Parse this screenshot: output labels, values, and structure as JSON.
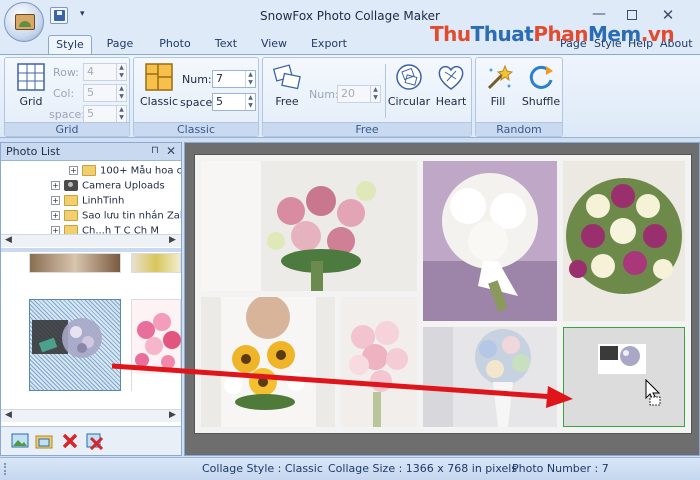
{
  "window": {
    "title": "SnowFox Photo Collage Maker",
    "qa_menu": "▾",
    "min": "—",
    "close": "✕"
  },
  "watermark": {
    "a": "Thu",
    "b": "Thuat",
    "c": "Phan",
    "d": "Mem",
    "e": ".vn"
  },
  "tabs": [
    "Style",
    "Page",
    "Photo",
    "Text",
    "View",
    "Export"
  ],
  "tabs_right": [
    "Page",
    "Style",
    "Help",
    "About"
  ],
  "ribbon": {
    "grid_group": {
      "label": "Grid",
      "button": "Grid",
      "row_label": "Row:",
      "row_value": "4",
      "col_label": "Col:",
      "col_value": "5",
      "space_label": "space:",
      "space_value": "5"
    },
    "classic_group": {
      "label": "Classic",
      "button": "Classic",
      "num_label": "Num:",
      "num_value": "7",
      "space_label": "space:",
      "space_value": "5"
    },
    "free_group": {
      "label": "Free",
      "free_button": "Free",
      "num_label": "Num:",
      "num_value": "20",
      "circular_button": "Circular",
      "heart_button": "Heart"
    },
    "random_group": {
      "label": "Random",
      "fill_button": "Fill",
      "shuffle_button": "Shuffle"
    }
  },
  "photo_list": {
    "title": "Photo List",
    "pin": "📌",
    "close": "✕",
    "tree": [
      {
        "label": "100+ Mẫu hoa c",
        "icon": "folder-icon"
      },
      {
        "label": "Camera Uploads",
        "icon": "camera-icon"
      },
      {
        "label": "LinhTinh",
        "icon": "folder-icon"
      },
      {
        "label": "Sao lưu tin nhắn Zalo",
        "icon": "folder-icon"
      },
      {
        "label": "Ch...h T C Ch M",
        "icon": "folder-icon"
      }
    ]
  },
  "status": {
    "style": "Collage Style : Classic",
    "size": "Collage Size : 1366 x 768  in pixels",
    "count": "Photo Number : 7"
  },
  "colors": {
    "accent": "#2b6cb5",
    "arrow": "#e0141b",
    "selected_cell": "#3aa53a"
  }
}
